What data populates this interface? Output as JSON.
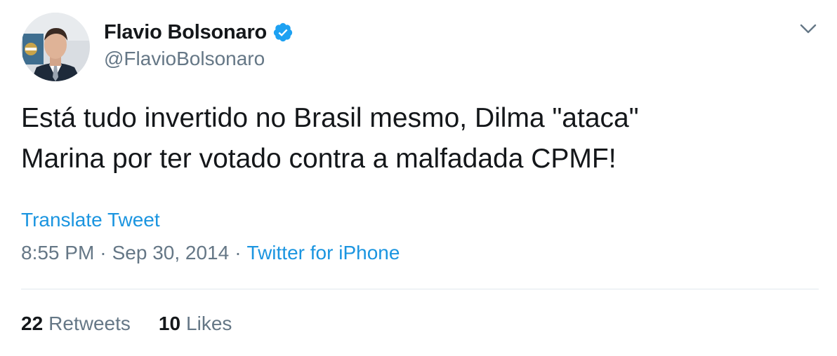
{
  "author": {
    "display_name": "Flavio Bolsonaro",
    "handle": "@FlavioBolsonaro",
    "verified": true
  },
  "tweet": {
    "text_line1": "Está tudo invertido no Brasil mesmo, Dilma \"ataca\"",
    "text_line2": "Marina por ter votado contra a malfadada CPMF!",
    "translate_label": "Translate Tweet",
    "time": "8:55 PM",
    "separator": "·",
    "date": "Sep 30, 2014",
    "source": "Twitter for iPhone"
  },
  "stats": {
    "retweets_count": "22",
    "retweets_label": "Retweets",
    "likes_count": "10",
    "likes_label": "Likes"
  },
  "icons": {
    "verified": "verified-badge-icon",
    "menu": "chevron-down-icon"
  },
  "colors": {
    "link": "#1b95e0",
    "secondary_text": "#657786",
    "primary_text": "#14171a",
    "divider": "#e1e8ed",
    "verified": "#1da1f2"
  }
}
